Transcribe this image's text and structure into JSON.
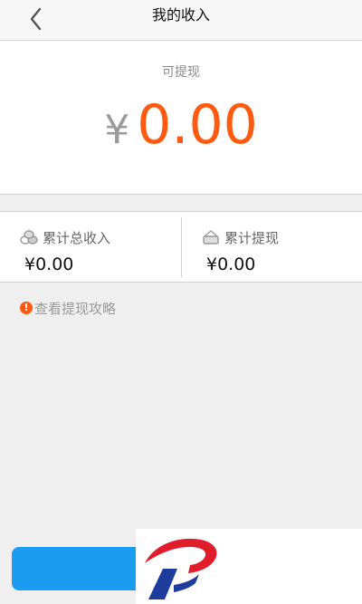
{
  "header": {
    "title": "我的收入",
    "back_icon": "chevron-left-icon"
  },
  "balance": {
    "label": "可提现",
    "currency": "¥",
    "amount": "0.00"
  },
  "stats": {
    "total_income": {
      "label": "累计总收入",
      "value": "¥0.00",
      "icon": "coins-icon"
    },
    "total_withdrawn": {
      "label": "累计提现",
      "value": "¥0.00",
      "icon": "wallet-icon"
    }
  },
  "guide": {
    "text": "查看提现攻略",
    "icon_glyph": "!"
  },
  "colors": {
    "accent": "#ff5a10",
    "button": "#1a9cf0",
    "logo_red": "#e01e2b",
    "logo_blue": "#1e3c9c"
  }
}
